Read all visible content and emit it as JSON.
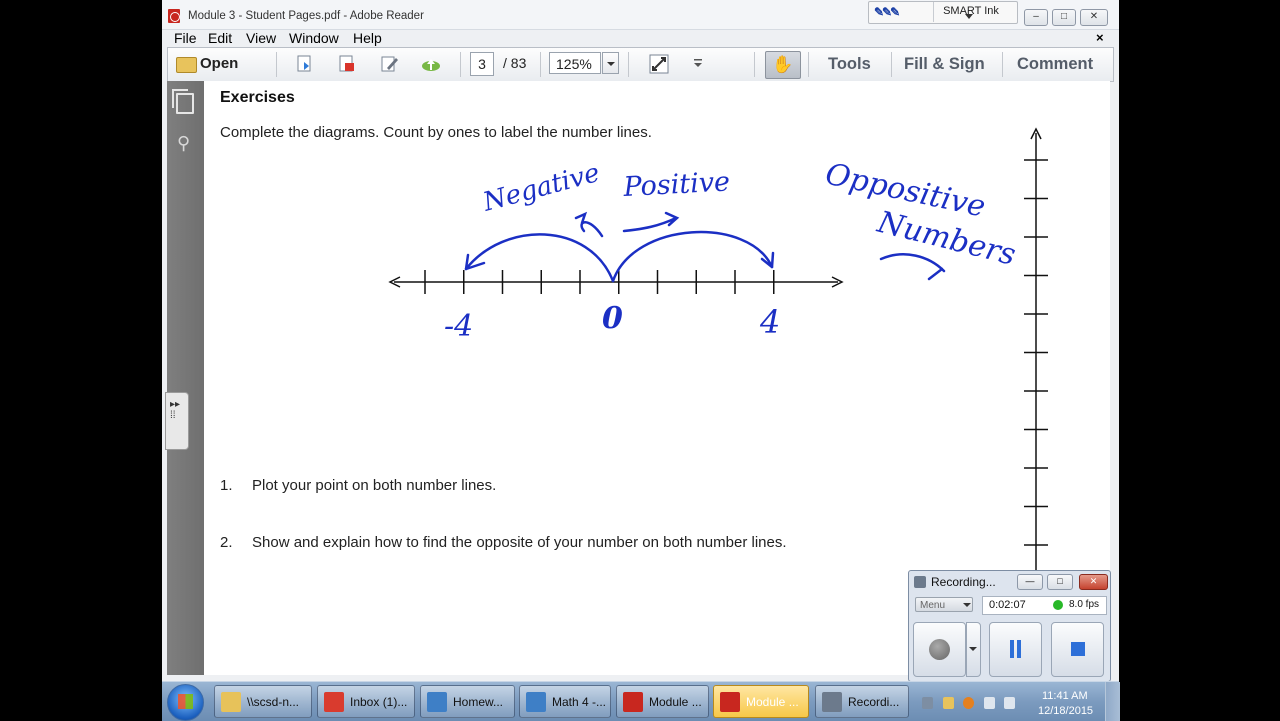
{
  "window": {
    "title": "Module 3 - Student Pages.pdf - Adobe Reader",
    "smart_ink_label": "SMART Ink",
    "min_label": "–",
    "max_label": "□",
    "close_label": "✕"
  },
  "menu": {
    "items": [
      "File",
      "Edit",
      "View",
      "Window",
      "Help"
    ],
    "doc_close": "×"
  },
  "toolbar": {
    "open_label": "Open",
    "page_current": "3",
    "page_total": "/   83",
    "zoom": "125%",
    "tabs": [
      "Tools",
      "Fill & Sign",
      "Comment"
    ]
  },
  "document": {
    "title": "Exercises",
    "instruction": "Complete the diagrams.  Count by ones to label the number lines.",
    "questions": [
      {
        "num": "1.",
        "text": "Plot your point on both number lines."
      },
      {
        "num": "2.",
        "text": "Show and explain how to find the opposite of your number on both number lines."
      }
    ],
    "handwriting": {
      "negative": "Negative",
      "positive": "Positive",
      "opposite_1": "Oppositive",
      "opposite_2": "Numbers",
      "label_neg4": "-4",
      "label_0": "0",
      "label_4": "4"
    },
    "number_line": {
      "min": -5,
      "max": 5,
      "labeled": [
        -4,
        0,
        4
      ]
    }
  },
  "recorder": {
    "title": "Recording...",
    "menu_label": "Menu",
    "time": "0:02:07",
    "fps": "8.0 fps",
    "status_color": "#28b828"
  },
  "taskbar": {
    "items": [
      {
        "label": "\\\\scsd-n...",
        "icon": "folder-icon",
        "color": "#e7c25a"
      },
      {
        "label": "Inbox (1)...",
        "icon": "chrome-icon",
        "color": "#d93b2e"
      },
      {
        "label": "Homew...",
        "icon": "notebook-icon",
        "color": "#3e7fc6"
      },
      {
        "label": "Math 4 -...",
        "icon": "notebook-icon",
        "color": "#3e7fc6"
      },
      {
        "label": "Module ...",
        "icon": "pdf-icon",
        "color": "#c8271f"
      },
      {
        "label": "Module ...",
        "icon": "pdf-icon",
        "color": "#c8271f",
        "active": true
      },
      {
        "label": "Recordi...",
        "icon": "recorder-icon",
        "color": "#6c7a8c"
      }
    ],
    "clock_time": "11:41 AM",
    "clock_date": "12/18/2015"
  }
}
